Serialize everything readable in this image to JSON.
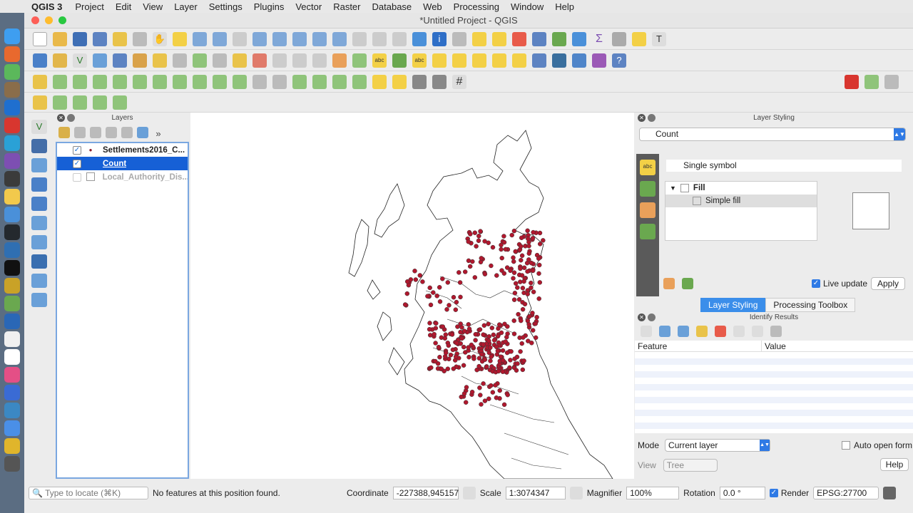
{
  "menubar": {
    "app": "QGIS 3",
    "items": [
      "Project",
      "Edit",
      "View",
      "Layer",
      "Settings",
      "Plugins",
      "Vector",
      "Raster",
      "Database",
      "Web",
      "Processing",
      "Window",
      "Help"
    ]
  },
  "window": {
    "title": "*Untitled Project - QGIS"
  },
  "layers_panel": {
    "title": "Layers",
    "layers": [
      {
        "name": "Settlements2016_C...",
        "checked": true
      },
      {
        "name": "Count",
        "checked": true
      },
      {
        "name": "Local_Authority_Dis...",
        "checked": false
      }
    ]
  },
  "layer_styling": {
    "title": "Layer Styling",
    "layer": "Count",
    "renderer": "Single symbol",
    "tree": {
      "fill": "Fill",
      "simple_fill": "Simple fill"
    },
    "live_update": "Live update",
    "apply": "Apply",
    "tabs": [
      "Layer Styling",
      "Processing Toolbox"
    ]
  },
  "identify": {
    "title": "Identify Results",
    "col_feature": "Feature",
    "col_value": "Value",
    "mode_label": "Mode",
    "mode_value": "Current layer",
    "auto_open": "Auto open form",
    "view_label": "View",
    "view_value": "Tree",
    "help": "Help"
  },
  "statusbar": {
    "locate_placeholder": "Type to locate (⌘K)",
    "message": "No features at this position found.",
    "coordinate_label": "Coordinate",
    "coordinate": "-227388,945157",
    "scale_label": "Scale",
    "scale": "1:3074347",
    "magnifier_label": "Magnifier",
    "magnifier": "100%",
    "rotation_label": "Rotation",
    "rotation": "0.0 °",
    "render": "Render",
    "crs": "EPSG:27700"
  },
  "colors": {
    "point": "#b0182e",
    "selection": "#1660d6",
    "accent": "#3b8eea"
  }
}
